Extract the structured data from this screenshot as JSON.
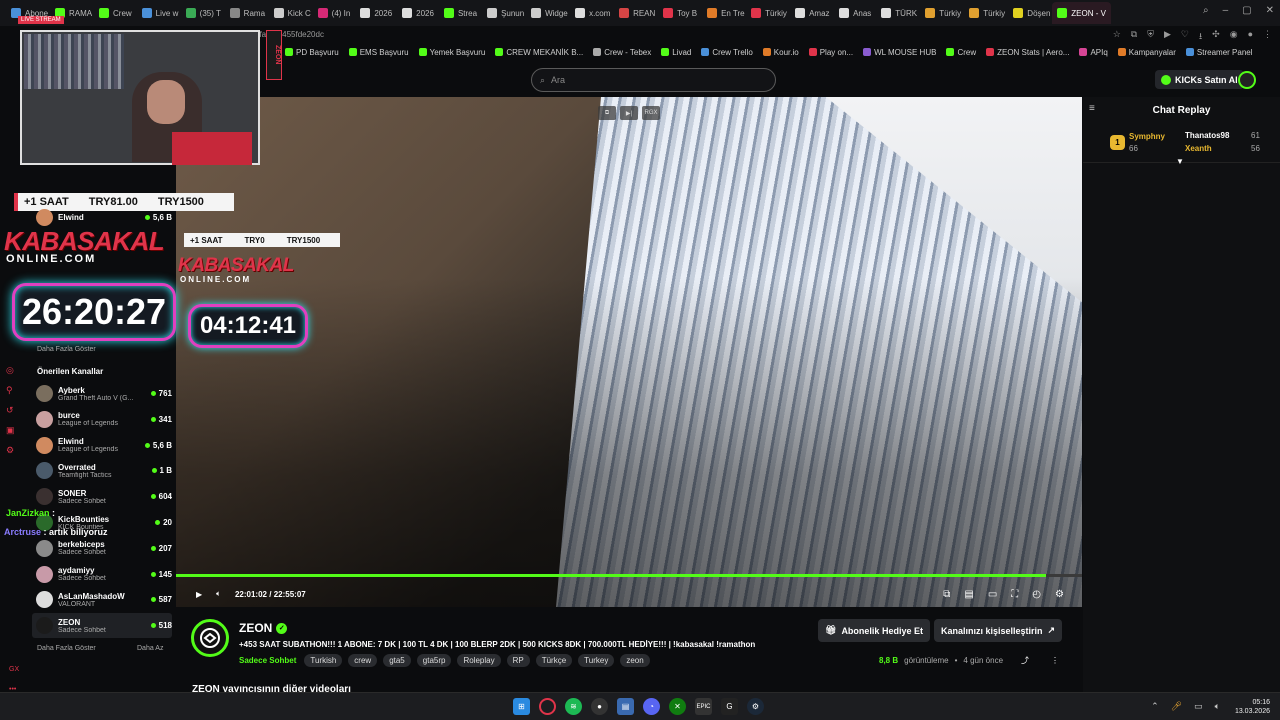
{
  "browser": {
    "tabs": [
      {
        "label": "Abone",
        "color": "#4a90d9"
      },
      {
        "label": "RAMA",
        "color": "#53fc18"
      },
      {
        "label": "Crew",
        "color": "#53fc18"
      },
      {
        "label": "Live w",
        "color": "#4a90d9"
      },
      {
        "label": "(35) T",
        "color": "#3aaa55"
      },
      {
        "label": "Rama",
        "color": "#888888"
      },
      {
        "label": "Kick C",
        "color": "#cccccc"
      },
      {
        "label": "(4) In",
        "color": "#d62976"
      },
      {
        "label": "2026",
        "color": "#dddddd"
      },
      {
        "label": "2026",
        "color": "#dddddd"
      },
      {
        "label": "Strea",
        "color": "#53fc18"
      },
      {
        "label": "Şunun",
        "color": "#cccccc"
      },
      {
        "label": "Widge",
        "color": "#cccccc"
      },
      {
        "label": "x.com",
        "color": "#dddddd"
      },
      {
        "label": "REAN",
        "color": "#d64545"
      },
      {
        "label": "Toy B",
        "color": "#e0344a"
      },
      {
        "label": "En Tre",
        "color": "#e07b28"
      },
      {
        "label": "Türkiy",
        "color": "#e0344a"
      },
      {
        "label": "Amaz",
        "color": "#dddddd"
      },
      {
        "label": "Anas",
        "color": "#dddddd"
      },
      {
        "label": "TÜRK",
        "color": "#dddddd"
      },
      {
        "label": "Türkiy",
        "color": "#e0a030"
      },
      {
        "label": "Türkiy",
        "color": "#e0a030"
      },
      {
        "label": "Döşen",
        "color": "#e0d020"
      },
      {
        "label": "ZEON - V",
        "color": "#53fc18",
        "active": true
      }
    ],
    "address": "8fae-12455fde20dc",
    "bookmarks": [
      {
        "label": "PD Başvuru",
        "color": "#53fc18"
      },
      {
        "label": "EMS Başvuru",
        "color": "#53fc18"
      },
      {
        "label": "Yemek Başvuru",
        "color": "#53fc18"
      },
      {
        "label": "CREW MEKANİK B...",
        "color": "#53fc18"
      },
      {
        "label": "Crew - Tebex",
        "color": "#aaaaaa"
      },
      {
        "label": "Livad",
        "color": "#53fc18"
      },
      {
        "label": "Crew Trello",
        "color": "#4a90d9"
      },
      {
        "label": "Kour.io",
        "color": "#e07b28"
      },
      {
        "label": "Play on...",
        "color": "#e0344a"
      },
      {
        "label": "WL MOUSE HUB",
        "color": "#8a5cd0"
      },
      {
        "label": "Crew",
        "color": "#53fc18"
      },
      {
        "label": "ZEON Stats | Aero...",
        "color": "#e0344a"
      },
      {
        "label": "APIq",
        "color": "#d64595"
      },
      {
        "label": "Kampanyalar",
        "color": "#e07b28"
      },
      {
        "label": "Streamer Panel",
        "color": "#4a90d9"
      }
    ]
  },
  "header": {
    "search_placeholder": "Ara",
    "buy_kicks": "KICKs Satın Al"
  },
  "overlay": {
    "live_badge": "LIVE STREAM",
    "zeon_logo": "ZEON",
    "price_large": {
      "a": "+1 SAAT",
      "b": "TRY81.00",
      "c": "TRY1500"
    },
    "price_small": {
      "a": "+1 SAAT",
      "b": "TRY0",
      "c": "TRY1500"
    },
    "brand_large": "KABASAKAL",
    "brand_large_sub": "ONLINE.COM",
    "brand_small": "KABASAKAL",
    "brand_small_sub": "ONLINE.COM",
    "timer_large": "26:20:27",
    "timer_small": "04:12:41",
    "top_channel": {
      "name": "Elwind",
      "viewers": "5,6 B"
    },
    "daha_fazla_top": "Daha Fazla Göster"
  },
  "sidebar": {
    "title": "Önerilen Kanallar",
    "channels": [
      {
        "name": "Ayberk",
        "game": "Grand Theft Auto V (G...",
        "viewers": "761",
        "color": "#7a6e5e"
      },
      {
        "name": "burce",
        "game": "League of Legends",
        "viewers": "341",
        "color": "#c9a0a0"
      },
      {
        "name": "Elwind",
        "game": "League of Legends",
        "viewers": "5,6 B",
        "color": "#d08a60"
      },
      {
        "name": "Overrated",
        "game": "Teamfight Tactics",
        "viewers": "1 B",
        "color": "#4a5a6a"
      },
      {
        "name": "SONER",
        "game": "Sadece Sohbet",
        "viewers": "604",
        "color": "#3a3030"
      },
      {
        "name": "KickBounties",
        "game": "KICK Bounties",
        "viewers": "20",
        "color": "#2a6a2a"
      },
      {
        "name": "berkebiceps",
        "game": "Sadece Sohbet",
        "viewers": "207",
        "color": "#8a8a8a"
      },
      {
        "name": "aydamiyy",
        "game": "Sadece Sohbet",
        "viewers": "145",
        "color": "#c89aa8"
      },
      {
        "name": "AsLanMashadoW",
        "game": "VALORANT",
        "viewers": "587",
        "color": "#dddddd"
      },
      {
        "name": "ZEON",
        "game": "Sadece Sohbet",
        "viewers": "518",
        "color": "#1b1b1b"
      }
    ],
    "show_more": "Daha Fazla Göster",
    "show_less": "Daha Az"
  },
  "video": {
    "current_time": "22:01:02",
    "separator": "/",
    "duration": "22:55:07",
    "progress": 0.96,
    "overlay_badge": "RGX"
  },
  "chat": {
    "title": "Chat Replay",
    "leaders": [
      {
        "rank": "1",
        "name": "Symphny",
        "score": "66",
        "color": "#e8b830"
      },
      {
        "name": "Thanatos98",
        "score": "61",
        "color": "#ffffff"
      },
      {
        "name": "Xeanth",
        "score": "56",
        "color": "#e8b830"
      }
    ]
  },
  "chat_overlay": [
    {
      "user": "JanZizkan",
      "msg": ":",
      "color": "#53fc18"
    },
    {
      "user": "Arctruse",
      "msg": ": artık biliyoruz",
      "color": "#8a7cff"
    }
  ],
  "stream": {
    "name": "ZEON",
    "title": "+453 SAAT SUBATHON!!! 1 ABONE: 7 DK | 100 TL 4 DK | 100 BLERP 2DK | 500 KICKS 8DK | 700.000TL HEDİYE!!! | !kabasakal !ramathon",
    "category": "Sadece Sohbet",
    "tags": [
      "Turkish",
      "crew",
      "gta5",
      "gta5rp",
      "Roleplay",
      "RP",
      "Türkçe",
      "Turkey",
      "zeon"
    ],
    "gift_sub": "Abonelik Hediye Et",
    "customize": "Kanalınızı kişiselleştirin",
    "views": "8,8 B",
    "views_label": "görüntüleme",
    "dot": "•",
    "age": "4 gün önce",
    "other_videos": "ZEON yayıncısının diğer videoları"
  },
  "taskbar": {
    "time": "05:16",
    "date": "13.03.2026"
  },
  "colors": {
    "accent": "#53fc18",
    "brand_red": "#e0344a",
    "bg": "#0b0c0e"
  }
}
